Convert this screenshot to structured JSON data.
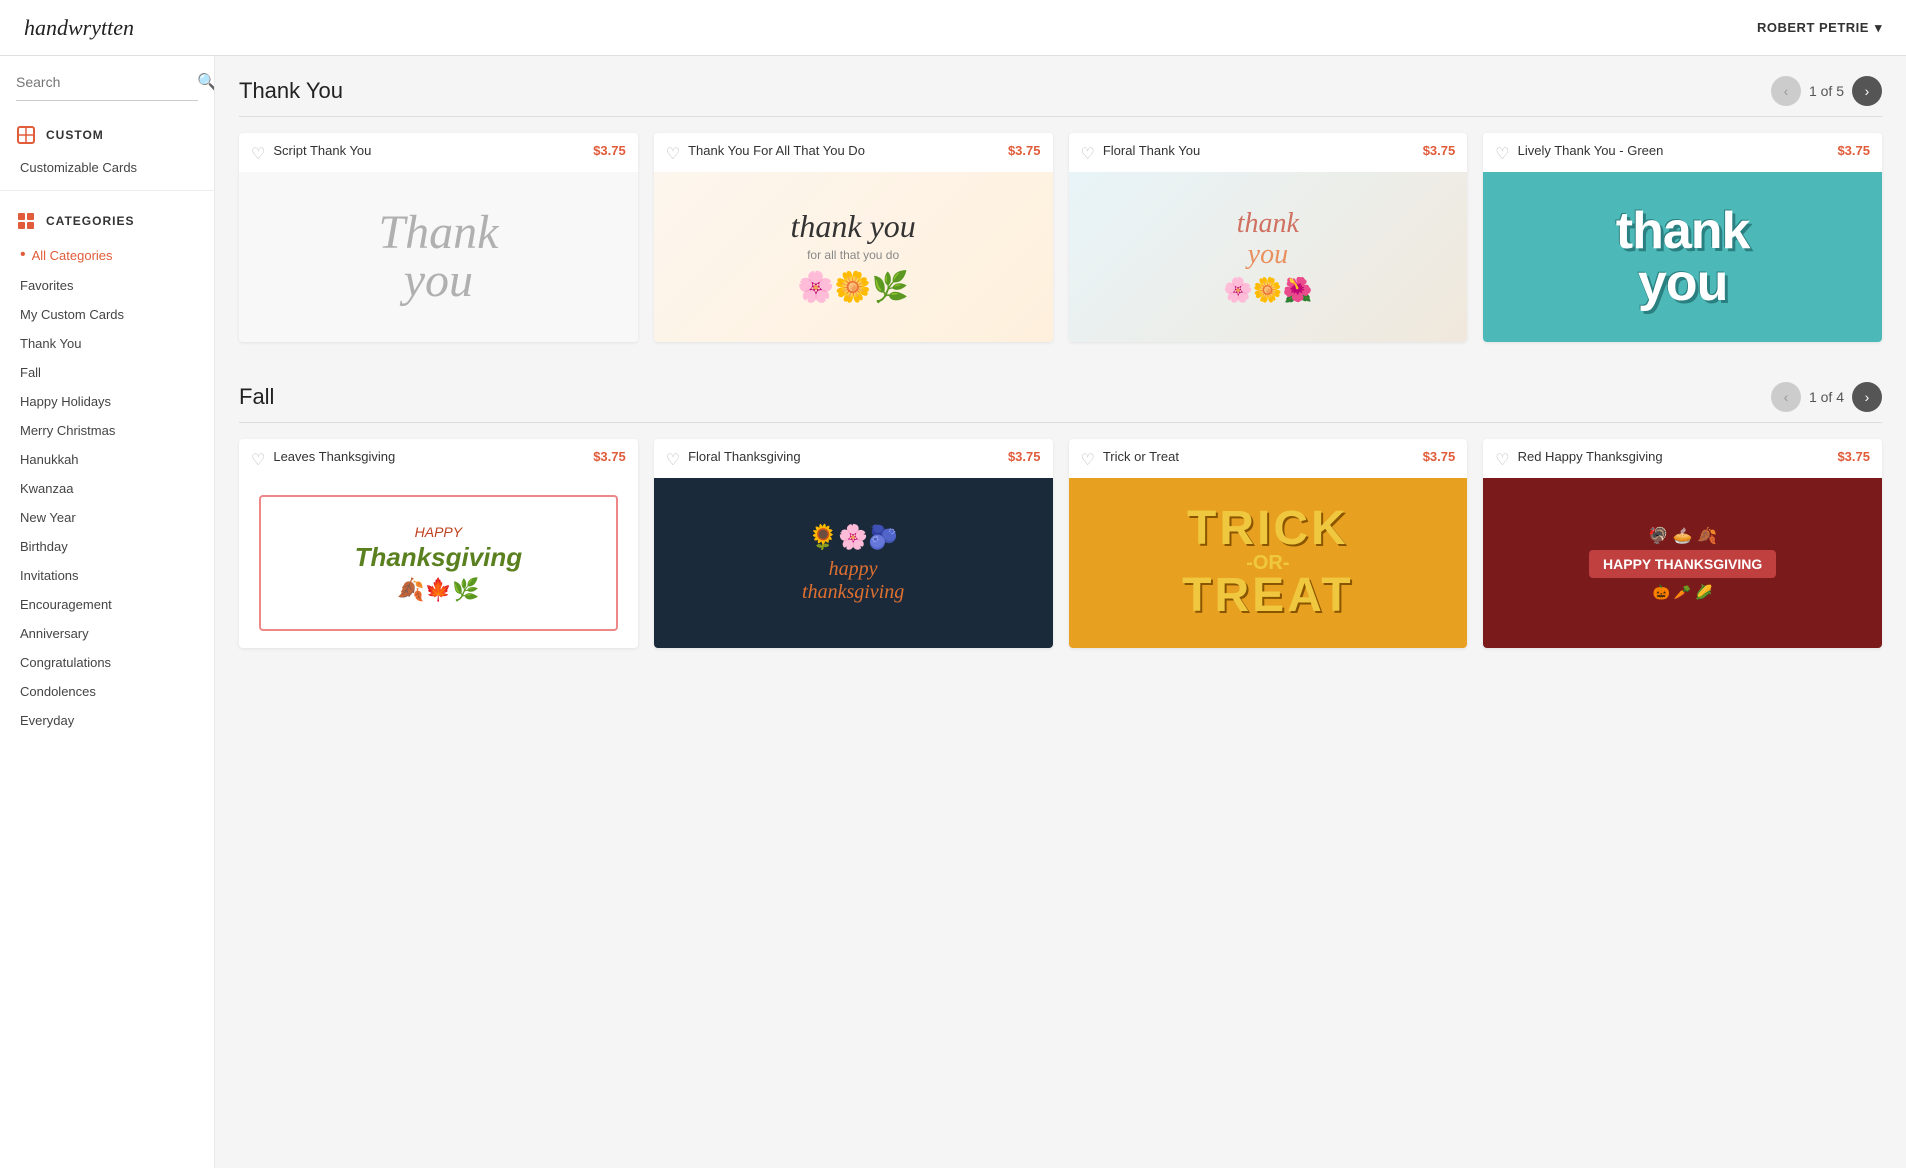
{
  "header": {
    "logo": "handwrytten",
    "user_name": "ROBERT PETRIE",
    "chevron": "▾"
  },
  "sidebar": {
    "search_placeholder": "Search",
    "custom_section": {
      "label": "CUSTOM",
      "items": [
        {
          "id": "customizable-cards",
          "label": "Customizable Cards"
        }
      ]
    },
    "categories_section": {
      "label": "CATEGORIES",
      "items": [
        {
          "id": "all-categories",
          "label": "All Categories",
          "active": true
        },
        {
          "id": "favorites",
          "label": "Favorites",
          "active": false
        },
        {
          "id": "my-custom-cards",
          "label": "My Custom Cards",
          "active": false
        },
        {
          "id": "thank-you",
          "label": "Thank You",
          "active": false
        },
        {
          "id": "fall",
          "label": "Fall",
          "active": false
        },
        {
          "id": "happy-holidays",
          "label": "Happy Holidays",
          "active": false
        },
        {
          "id": "merry-christmas",
          "label": "Merry Christmas",
          "active": false
        },
        {
          "id": "hanukkah",
          "label": "Hanukkah",
          "active": false
        },
        {
          "id": "kwanzaa",
          "label": "Kwanzaa",
          "active": false
        },
        {
          "id": "new-year",
          "label": "New Year",
          "active": false
        },
        {
          "id": "birthday",
          "label": "Birthday",
          "active": false
        },
        {
          "id": "invitations",
          "label": "Invitations",
          "active": false
        },
        {
          "id": "encouragement",
          "label": "Encouragement",
          "active": false
        },
        {
          "id": "anniversary",
          "label": "Anniversary",
          "active": false
        },
        {
          "id": "congratulations",
          "label": "Congratulations",
          "active": false
        },
        {
          "id": "condolences",
          "label": "Condolences",
          "active": false
        },
        {
          "id": "everyday",
          "label": "Everyday",
          "active": false
        }
      ]
    }
  },
  "sections": [
    {
      "id": "thank-you-section",
      "title": "Thank You",
      "pagination": {
        "current": 1,
        "total": 5,
        "label": "1 of 5"
      },
      "cards": [
        {
          "id": "script-thank-you",
          "name": "Script Thank You",
          "price": "$3.75",
          "image_type": "script-thank-you"
        },
        {
          "id": "thank-you-for-all",
          "name": "Thank You For All That You Do",
          "price": "$3.75",
          "image_type": "thank-you-flowers"
        },
        {
          "id": "floral-thank-you",
          "name": "Floral Thank You",
          "price": "$3.75",
          "image_type": "floral-thank-you"
        },
        {
          "id": "lively-thank-you-green",
          "name": "Lively Thank You - Green",
          "price": "$3.75",
          "image_type": "lively-thank-you"
        }
      ]
    },
    {
      "id": "fall-section",
      "title": "Fall",
      "pagination": {
        "current": 1,
        "total": 4,
        "label": "1 of 4"
      },
      "cards": [
        {
          "id": "leaves-thanksgiving",
          "name": "Leaves Thanksgiving",
          "price": "$3.75",
          "image_type": "leaves-thanksgiving"
        },
        {
          "id": "floral-thanksgiving",
          "name": "Floral Thanksgiving",
          "price": "$3.75",
          "image_type": "floral-thanksgiving"
        },
        {
          "id": "trick-or-treat",
          "name": "Trick or Treat",
          "price": "$3.75",
          "image_type": "trick-or-treat"
        },
        {
          "id": "red-happy-thanksgiving",
          "name": "Red Happy Thanksgiving",
          "price": "$3.75",
          "image_type": "red-thanksgiving"
        }
      ]
    }
  ]
}
